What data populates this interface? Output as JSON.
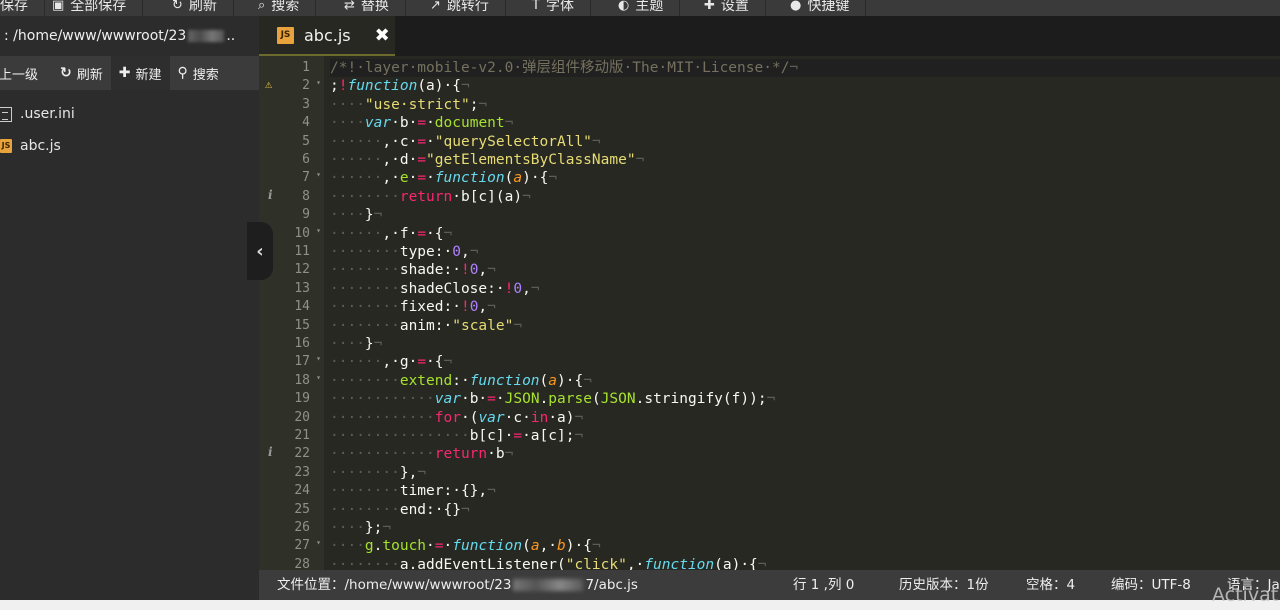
{
  "menubar": {
    "items": [
      {
        "label": "保存",
        "icon": "save-icon"
      },
      {
        "label": "全部保存",
        "icon": "save-all-icon"
      },
      {
        "label": "刷新",
        "icon": "refresh-icon"
      },
      {
        "label": "搜索",
        "icon": "search-icon"
      },
      {
        "label": "替换",
        "icon": "replace-icon"
      },
      {
        "label": "跳转行",
        "icon": "jump-icon"
      },
      {
        "label": "字体",
        "icon": "font-icon"
      },
      {
        "label": "主题",
        "icon": "theme-icon"
      },
      {
        "label": "设置",
        "icon": "settings-icon"
      },
      {
        "label": "快捷键",
        "icon": "keyboard-icon"
      }
    ]
  },
  "sidebar": {
    "path_prefix": ": /home/www/wwwroot/23",
    "path_suffix": "..",
    "tools": {
      "up": "上一级",
      "refresh": "刷新",
      "new": "新建",
      "search": "搜索"
    },
    "files": [
      {
        "name": ".user.ini",
        "type": "doc"
      },
      {
        "name": "abc.js",
        "type": "js"
      }
    ]
  },
  "editor": {
    "tab": {
      "label": "abc.js",
      "icon_text": "JS",
      "close": "✖"
    },
    "lines": [
      {
        "n": "1"
      },
      {
        "n": "2",
        "fold": true,
        "mark": "warn"
      },
      {
        "n": "3"
      },
      {
        "n": "4"
      },
      {
        "n": "5"
      },
      {
        "n": "6"
      },
      {
        "n": "7",
        "fold": true
      },
      {
        "n": "8",
        "mark": "info"
      },
      {
        "n": "9"
      },
      {
        "n": "10",
        "fold": true
      },
      {
        "n": "11"
      },
      {
        "n": "12"
      },
      {
        "n": "13"
      },
      {
        "n": "14"
      },
      {
        "n": "15"
      },
      {
        "n": "16"
      },
      {
        "n": "17",
        "fold": true
      },
      {
        "n": "18",
        "fold": true
      },
      {
        "n": "19"
      },
      {
        "n": "20"
      },
      {
        "n": "21"
      },
      {
        "n": "22",
        "mark": "info"
      },
      {
        "n": "23"
      },
      {
        "n": "24"
      },
      {
        "n": "25"
      },
      {
        "n": "26"
      },
      {
        "n": "27",
        "fold": true
      },
      {
        "n": "28"
      }
    ],
    "code": [
      [
        [
          "c",
          "/*!·layer·mobile-v2.0·弹层组件移动版·The·MIT·License·*/"
        ],
        [
          "e",
          "¬"
        ]
      ],
      [
        [
          "pl",
          ";"
        ],
        [
          "k",
          "!"
        ],
        [
          "f",
          "function"
        ],
        [
          "pl",
          "(a)·{"
        ],
        [
          "e",
          "¬"
        ]
      ],
      [
        [
          "i",
          "····"
        ],
        [
          "s",
          "\"use·strict\""
        ],
        [
          "pl",
          ";"
        ],
        [
          "e",
          "¬"
        ]
      ],
      [
        [
          "i",
          "····"
        ],
        [
          "f",
          "var"
        ],
        [
          "pl",
          "·b·"
        ],
        [
          "o",
          "="
        ],
        [
          "pl",
          "·"
        ],
        [
          "g",
          "document"
        ],
        [
          "e",
          "¬"
        ]
      ],
      [
        [
          "i",
          "······"
        ],
        [
          "pl",
          ",·c·"
        ],
        [
          "o",
          "="
        ],
        [
          "pl",
          "·"
        ],
        [
          "s",
          "\"querySelectorAll\""
        ],
        [
          "e",
          "¬"
        ]
      ],
      [
        [
          "i",
          "······"
        ],
        [
          "pl",
          ",·d·"
        ],
        [
          "o",
          "="
        ],
        [
          "s",
          "\"getElementsByClassName\""
        ],
        [
          "e",
          "¬"
        ]
      ],
      [
        [
          "i",
          "······"
        ],
        [
          "pl",
          ",·"
        ],
        [
          "g",
          "e"
        ],
        [
          "pl",
          "·"
        ],
        [
          "o",
          "="
        ],
        [
          "pl",
          "·"
        ],
        [
          "f",
          "function"
        ],
        [
          "pl",
          "("
        ],
        [
          "p",
          "a"
        ],
        [
          "pl",
          ")·{"
        ],
        [
          "e",
          "¬"
        ]
      ],
      [
        [
          "i",
          "········"
        ],
        [
          "k",
          "return"
        ],
        [
          "pl",
          "·b[c](a)"
        ],
        [
          "e",
          "¬"
        ]
      ],
      [
        [
          "i",
          "····"
        ],
        [
          "pl",
          "}"
        ],
        [
          "e",
          "¬"
        ]
      ],
      [
        [
          "i",
          "······"
        ],
        [
          "pl",
          ",·f·"
        ],
        [
          "o",
          "="
        ],
        [
          "pl",
          "·{"
        ],
        [
          "e",
          "¬"
        ]
      ],
      [
        [
          "i",
          "········"
        ],
        [
          "pl",
          "type:·"
        ],
        [
          "n",
          "0"
        ],
        [
          "pl",
          ","
        ],
        [
          "e",
          "¬"
        ]
      ],
      [
        [
          "i",
          "········"
        ],
        [
          "pl",
          "shade:·"
        ],
        [
          "k",
          "!"
        ],
        [
          "n",
          "0"
        ],
        [
          "pl",
          ","
        ],
        [
          "e",
          "¬"
        ]
      ],
      [
        [
          "i",
          "········"
        ],
        [
          "pl",
          "shadeClose:·"
        ],
        [
          "k",
          "!"
        ],
        [
          "n",
          "0"
        ],
        [
          "pl",
          ","
        ],
        [
          "e",
          "¬"
        ]
      ],
      [
        [
          "i",
          "········"
        ],
        [
          "pl",
          "fixed:·"
        ],
        [
          "k",
          "!"
        ],
        [
          "n",
          "0"
        ],
        [
          "pl",
          ","
        ],
        [
          "e",
          "¬"
        ]
      ],
      [
        [
          "i",
          "········"
        ],
        [
          "pl",
          "anim:·"
        ],
        [
          "s",
          "\"scale\""
        ],
        [
          "e",
          "¬"
        ]
      ],
      [
        [
          "i",
          "····"
        ],
        [
          "pl",
          "}"
        ],
        [
          "e",
          "¬"
        ]
      ],
      [
        [
          "i",
          "······"
        ],
        [
          "pl",
          ",·g·"
        ],
        [
          "o",
          "="
        ],
        [
          "pl",
          "·{"
        ],
        [
          "e",
          "¬"
        ]
      ],
      [
        [
          "i",
          "········"
        ],
        [
          "g",
          "extend"
        ],
        [
          "pl",
          ":·"
        ],
        [
          "f",
          "function"
        ],
        [
          "pl",
          "("
        ],
        [
          "p",
          "a"
        ],
        [
          "pl",
          ")·{"
        ],
        [
          "e",
          "¬"
        ]
      ],
      [
        [
          "i",
          "············"
        ],
        [
          "f",
          "var"
        ],
        [
          "pl",
          "·b·"
        ],
        [
          "o",
          "="
        ],
        [
          "pl",
          "·"
        ],
        [
          "g",
          "JSON"
        ],
        [
          "pl",
          "."
        ],
        [
          "g",
          "parse"
        ],
        [
          "pl",
          "("
        ],
        [
          "g",
          "JSON"
        ],
        [
          "pl",
          ".stringify(f));"
        ],
        [
          "e",
          "¬"
        ]
      ],
      [
        [
          "i",
          "············"
        ],
        [
          "k",
          "for"
        ],
        [
          "pl",
          "·("
        ],
        [
          "f",
          "var"
        ],
        [
          "pl",
          "·c·"
        ],
        [
          "k",
          "in"
        ],
        [
          "pl",
          "·a)"
        ],
        [
          "e",
          "¬"
        ]
      ],
      [
        [
          "i",
          "················"
        ],
        [
          "pl",
          "b[c]·"
        ],
        [
          "o",
          "="
        ],
        [
          "pl",
          "·a[c];"
        ],
        [
          "e",
          "¬"
        ]
      ],
      [
        [
          "i",
          "············"
        ],
        [
          "k",
          "return"
        ],
        [
          "pl",
          "·b"
        ],
        [
          "e",
          "¬"
        ]
      ],
      [
        [
          "i",
          "········"
        ],
        [
          "pl",
          "},"
        ],
        [
          "e",
          "¬"
        ]
      ],
      [
        [
          "i",
          "········"
        ],
        [
          "pl",
          "timer:·{},"
        ],
        [
          "e",
          "¬"
        ]
      ],
      [
        [
          "i",
          "········"
        ],
        [
          "pl",
          "end:·{}"
        ],
        [
          "e",
          "¬"
        ]
      ],
      [
        [
          "i",
          "····"
        ],
        [
          "pl",
          "};"
        ],
        [
          "e",
          "¬"
        ]
      ],
      [
        [
          "i",
          "····"
        ],
        [
          "g",
          "g"
        ],
        [
          "pl",
          "."
        ],
        [
          "g",
          "touch"
        ],
        [
          "pl",
          "·"
        ],
        [
          "o",
          "="
        ],
        [
          "pl",
          "·"
        ],
        [
          "f",
          "function"
        ],
        [
          "pl",
          "("
        ],
        [
          "p",
          "a"
        ],
        [
          "pl",
          ",·"
        ],
        [
          "p",
          "b"
        ],
        [
          "pl",
          ")·{"
        ],
        [
          "e",
          "¬"
        ]
      ],
      [
        [
          "i",
          "········"
        ],
        [
          "pl",
          "a.addEventListener("
        ],
        [
          "s",
          "\"click\""
        ],
        [
          "pl",
          ",·"
        ],
        [
          "f",
          "function"
        ],
        [
          "pl",
          "(a)·{"
        ],
        [
          "e",
          "¬"
        ]
      ]
    ]
  },
  "statusbar": {
    "location_label": "文件位置：/home/www/wwwroot/23",
    "location_suffix": "7/abc.js",
    "cursor": "行 1 ,列 0",
    "history": "历史版本：1份",
    "spaces": "空格：4",
    "encoding": "编码：UTF-8",
    "language": "语言：Ja"
  },
  "watermark": "Activat"
}
